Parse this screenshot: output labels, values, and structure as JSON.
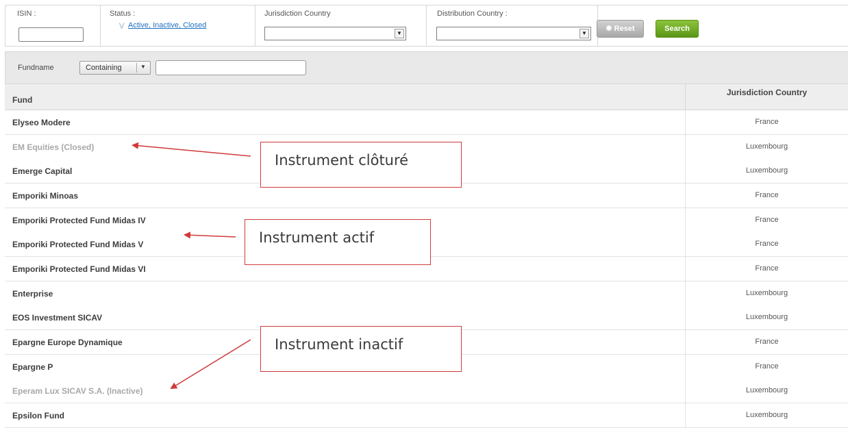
{
  "filters": {
    "isin_label": "ISIN :",
    "isin_value": "",
    "status_label": "Status :",
    "status_value": "Active, Inactive, Closed",
    "jurisdiction_label": "Jurisdiction Country",
    "jurisdiction_value": "",
    "distribution_label": "Distribution Country :",
    "distribution_value": "",
    "reset_label": "Reset",
    "search_label": "Search"
  },
  "fundname_filter": {
    "label": "Fundname",
    "mode": "Containing",
    "value": ""
  },
  "table": {
    "columns": [
      "Fund",
      "Jurisdiction Country"
    ],
    "rows": [
      {
        "fund": "Elyseo Modere",
        "country": "France",
        "status": "active"
      },
      {
        "fund": "EM Equities (Closed)",
        "country": "Luxembourg",
        "status": "closed"
      },
      {
        "fund": "Emerge Capital",
        "country": "Luxembourg",
        "status": "active"
      },
      {
        "fund": "Emporiki Minoas",
        "country": "France",
        "status": "active"
      },
      {
        "fund": "Emporiki Protected Fund Midas IV",
        "country": "France",
        "status": "active"
      },
      {
        "fund": "Emporiki Protected Fund Midas V",
        "country": "France",
        "status": "active"
      },
      {
        "fund": "Emporiki Protected Fund Midas VI",
        "country": "France",
        "status": "active"
      },
      {
        "fund": "Enterprise",
        "country": "Luxembourg",
        "status": "active"
      },
      {
        "fund": "EOS  Investment SICAV",
        "country": "Luxembourg",
        "status": "active"
      },
      {
        "fund": "Epargne Europe Dynamique",
        "country": "France",
        "status": "active"
      },
      {
        "fund": "Epargne P",
        "country": "France",
        "status": "active"
      },
      {
        "fund": "Eperam Lux SICAV S.A. (Inactive)",
        "country": "Luxembourg",
        "status": "inactive"
      },
      {
        "fund": "Epsilon Fund",
        "country": "Luxembourg",
        "status": "active"
      }
    ]
  },
  "annotations": {
    "closed": "Instrument clôturé",
    "active": "Instrument actif",
    "inactive": "Instrument inactif"
  },
  "colors": {
    "accent_link": "#1f6fbf",
    "search_button": "#6fa826",
    "annotation": "#d0393a",
    "muted_text": "#a8a8a8"
  }
}
